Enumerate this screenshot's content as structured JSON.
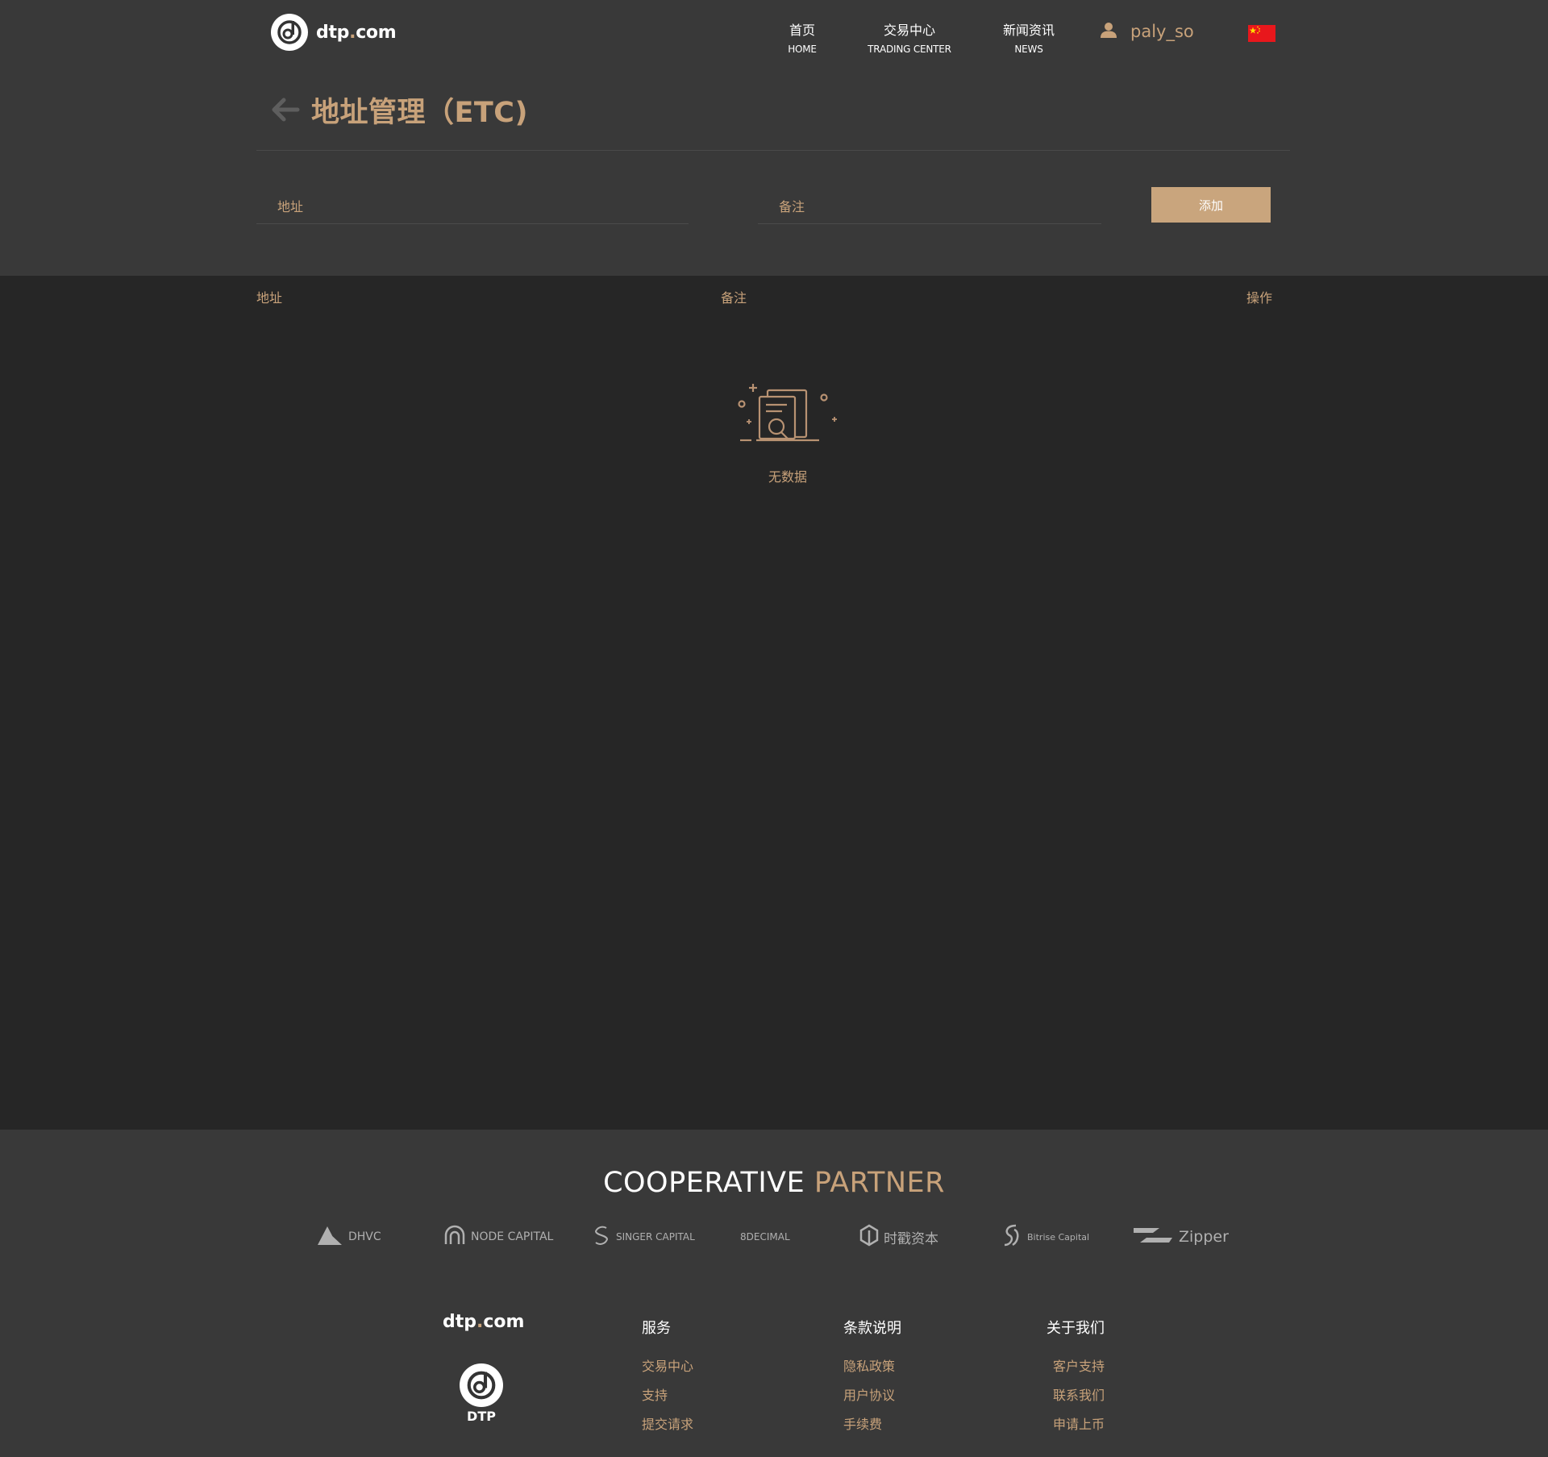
{
  "header": {
    "logo_text_pre": "dtp",
    "logo_text_dot": ".",
    "logo_text_post": "com",
    "nav": [
      {
        "zh": "首页",
        "en": "HOME"
      },
      {
        "zh": "交易中心",
        "en": "TRADING CENTER"
      },
      {
        "zh": "新闻资讯",
        "en": "NEWS"
      }
    ],
    "user_name": "paly_so",
    "language_flag": "china-flag-icon"
  },
  "page": {
    "title": "地址管理（ETC)",
    "address_placeholder": "地址",
    "remark_placeholder": "备注",
    "add_button": "添加"
  },
  "table": {
    "columns": [
      "地址",
      "备注",
      "操作"
    ],
    "rows": [],
    "empty_text": "无数据"
  },
  "footer": {
    "partner_title_1": "COOPERATIVE",
    "partner_title_2": "PARTNER",
    "partners": [
      "DHVC",
      "NODE CAPITAL",
      "SINGER CAPITAL",
      "8DECIMAL",
      "时戳资本",
      "Bitrise Capital",
      "Zipper"
    ],
    "logo_text_pre": "dtp",
    "logo_text_dot": ".",
    "logo_text_post": "com",
    "brand": "DTP",
    "columns": [
      {
        "title": "服务",
        "links": [
          "交易中心",
          "支持",
          "提交请求"
        ]
      },
      {
        "title": "条款说明",
        "links": [
          "隐私政策",
          "用户协议",
          "手续费"
        ]
      },
      {
        "title": "关于我们",
        "links": [
          "客户支持",
          "联系我们",
          "申请上币"
        ]
      }
    ]
  },
  "colors": {
    "accent": "#c8a27a",
    "button": "#c9a57d",
    "panel": "#393939",
    "background": "#262626"
  }
}
